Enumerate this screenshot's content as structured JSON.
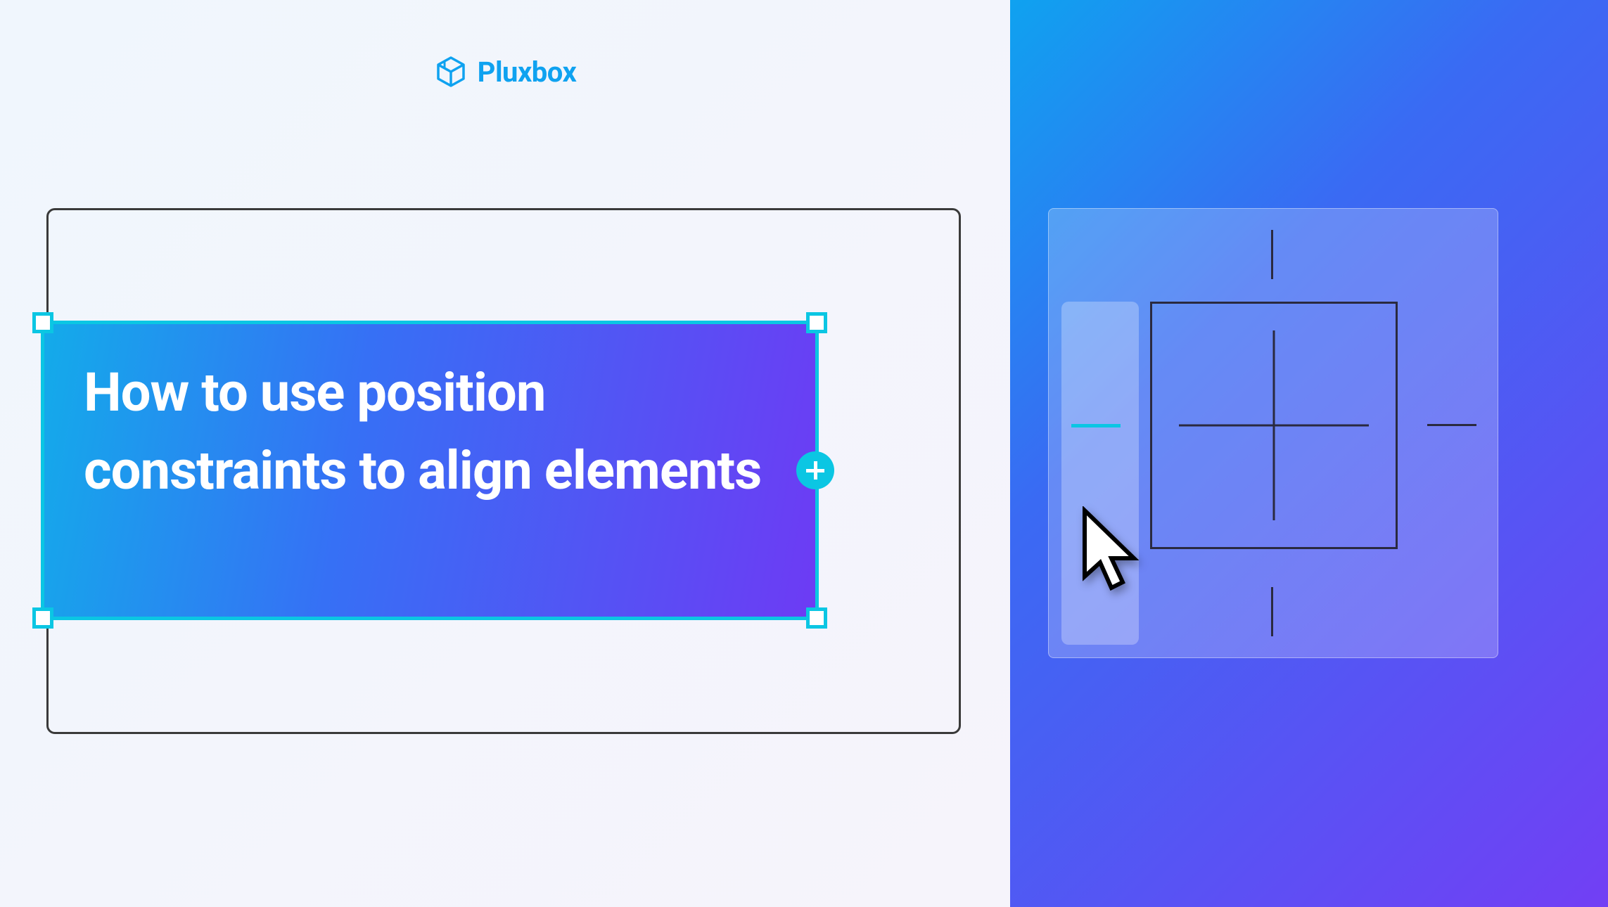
{
  "brand": {
    "name": "Pluxbox"
  },
  "title": "How to use position constraints to align elements",
  "constraints": {
    "active_side": "left"
  }
}
